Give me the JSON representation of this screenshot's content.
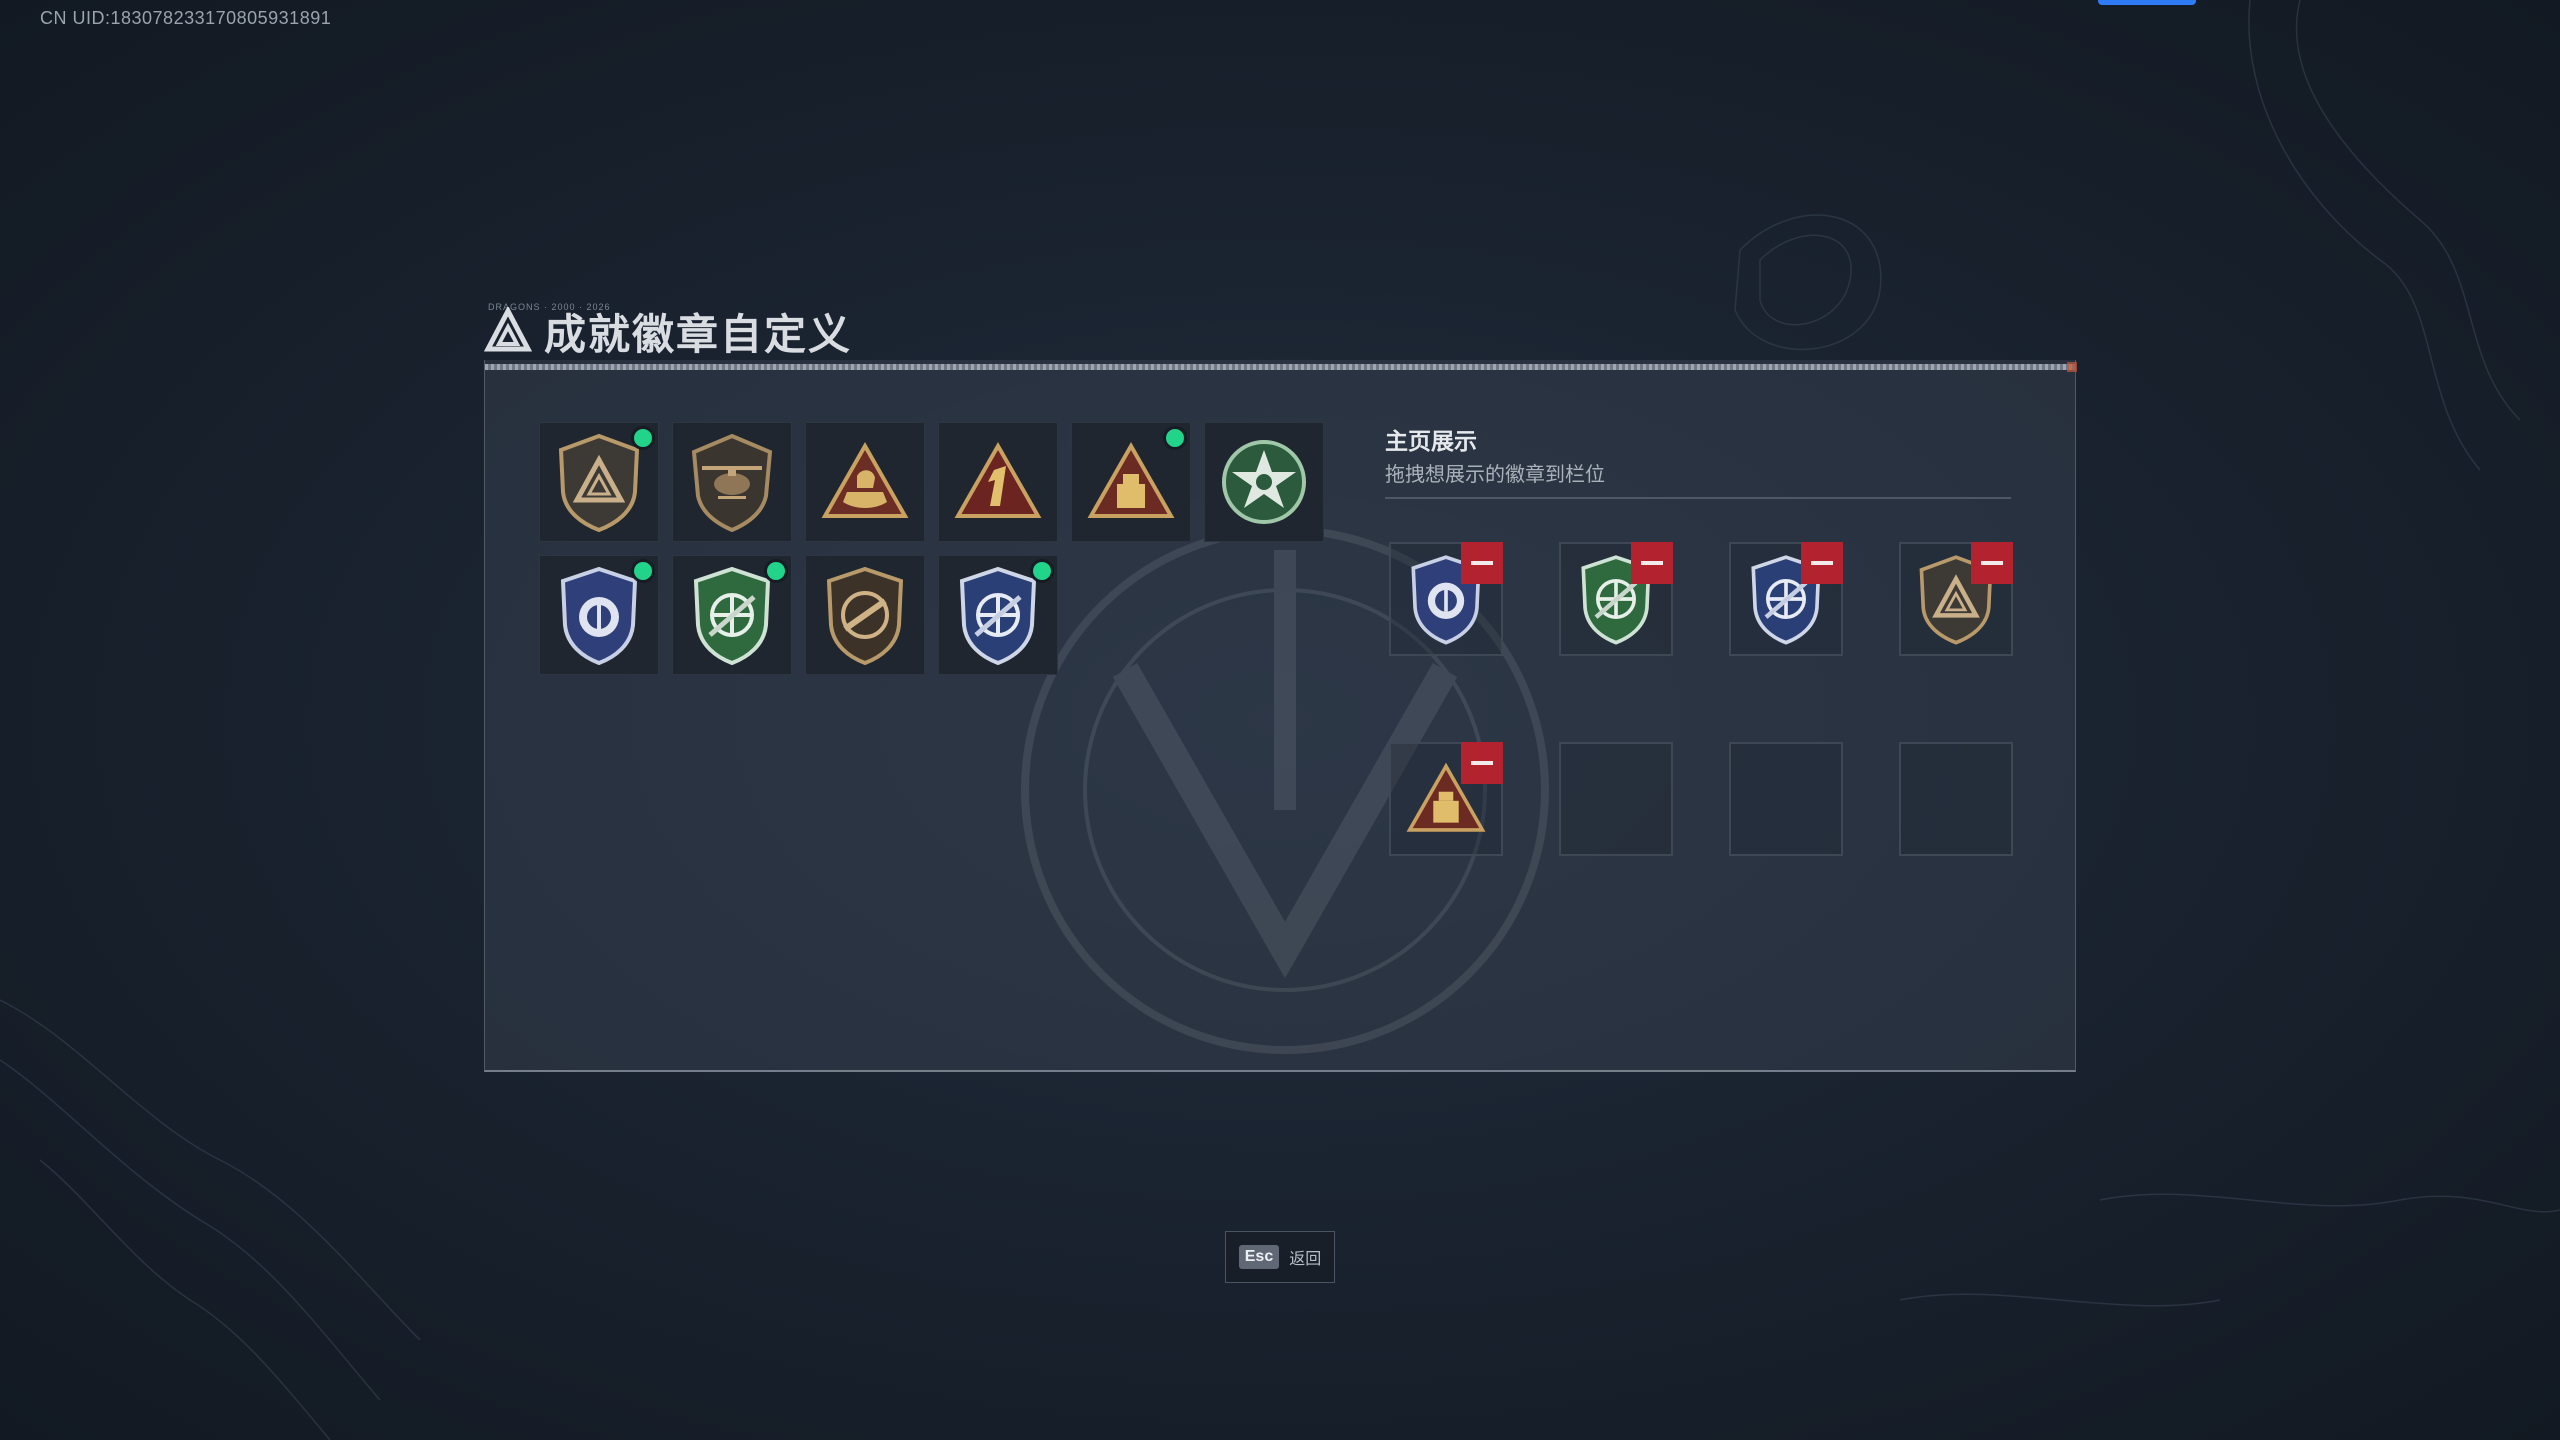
{
  "header": {
    "uid": "CN UID:183078233170805931891"
  },
  "title": {
    "text": "成就徽章自定义",
    "tiny": "DRAGONS · 2000 · 2026"
  },
  "badges": [
    {
      "icon": "shield-triangle-icon",
      "new": true
    },
    {
      "icon": "helicopter-badge-icon",
      "new": false
    },
    {
      "icon": "boat-triangle-icon",
      "new": false
    },
    {
      "icon": "number-one-triangle-icon",
      "new": false
    },
    {
      "icon": "gold-bar-triangle-icon",
      "new": true
    },
    {
      "icon": "green-star-emblem-icon",
      "new": false
    },
    {
      "icon": "blue-police-shield-icon",
      "new": true
    },
    {
      "icon": "green-crosshair-shield-icon",
      "new": true
    },
    {
      "icon": "brown-rifle-shield-icon",
      "new": false
    },
    {
      "icon": "blue-crosshair-shield-icon",
      "new": true
    }
  ],
  "showcase": {
    "title": "主页展示",
    "subtitle": "拖拽想展示的徽章到栏位",
    "slots": [
      {
        "icon": "blue-police-shield-icon",
        "filled": true
      },
      {
        "icon": "green-crosshair-shield-icon",
        "filled": true
      },
      {
        "icon": "blue-crosshair-shield-icon",
        "filled": true
      },
      {
        "icon": "shield-triangle-icon",
        "filled": true
      },
      {
        "icon": "gold-bar-triangle-icon",
        "filled": true
      },
      {
        "icon": "",
        "filled": false
      },
      {
        "icon": "",
        "filled": false
      },
      {
        "icon": "",
        "filled": false
      }
    ]
  },
  "footer": {
    "esc_key": "Esc",
    "esc_label": "返回"
  },
  "colors": {
    "new_dot": "#22d38a",
    "remove": "#b3232f",
    "accent_blue": "#2f7bf5"
  }
}
